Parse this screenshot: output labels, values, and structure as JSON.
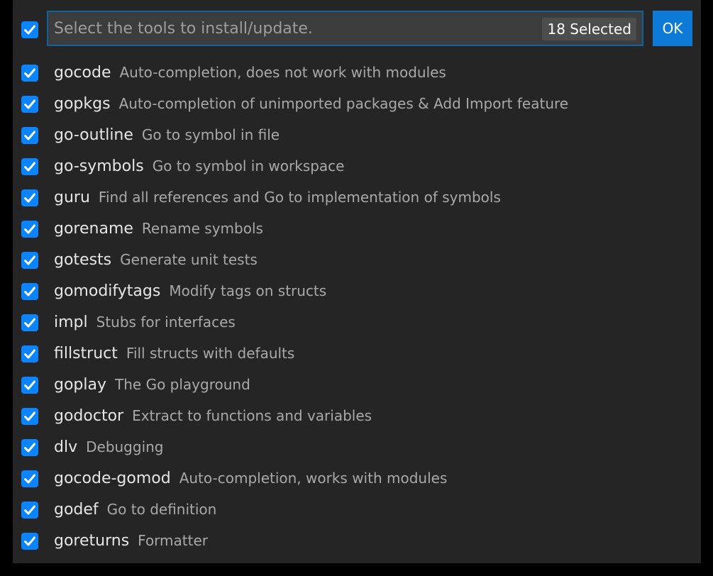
{
  "header": {
    "placeholder": "Select the tools to install/update.",
    "selected_count": "18 Selected",
    "ok_label": "OK"
  },
  "tools": [
    {
      "name": "gocode",
      "description": "Auto-completion, does not work with modules",
      "checked": true
    },
    {
      "name": "gopkgs",
      "description": "Auto-completion of unimported packages & Add Import feature",
      "checked": true
    },
    {
      "name": "go-outline",
      "description": "Go to symbol in file",
      "checked": true
    },
    {
      "name": "go-symbols",
      "description": "Go to symbol in workspace",
      "checked": true
    },
    {
      "name": "guru",
      "description": "Find all references and Go to implementation of symbols",
      "checked": true
    },
    {
      "name": "gorename",
      "description": "Rename symbols",
      "checked": true
    },
    {
      "name": "gotests",
      "description": "Generate unit tests",
      "checked": true
    },
    {
      "name": "gomodifytags",
      "description": "Modify tags on structs",
      "checked": true
    },
    {
      "name": "impl",
      "description": "Stubs for interfaces",
      "checked": true
    },
    {
      "name": "fillstruct",
      "description": "Fill structs with defaults",
      "checked": true
    },
    {
      "name": "goplay",
      "description": "The Go playground",
      "checked": true
    },
    {
      "name": "godoctor",
      "description": "Extract to functions and variables",
      "checked": true
    },
    {
      "name": "dlv",
      "description": "Debugging",
      "checked": true
    },
    {
      "name": "gocode-gomod",
      "description": "Auto-completion, works with modules",
      "checked": true
    },
    {
      "name": "godef",
      "description": "Go to definition",
      "checked": true
    },
    {
      "name": "goreturns",
      "description": "Formatter",
      "checked": true
    }
  ],
  "colors": {
    "accent": "#0a84ff",
    "panel": "#252526",
    "input_border": "#0e639c",
    "ok_button": "#0e7ad8"
  }
}
